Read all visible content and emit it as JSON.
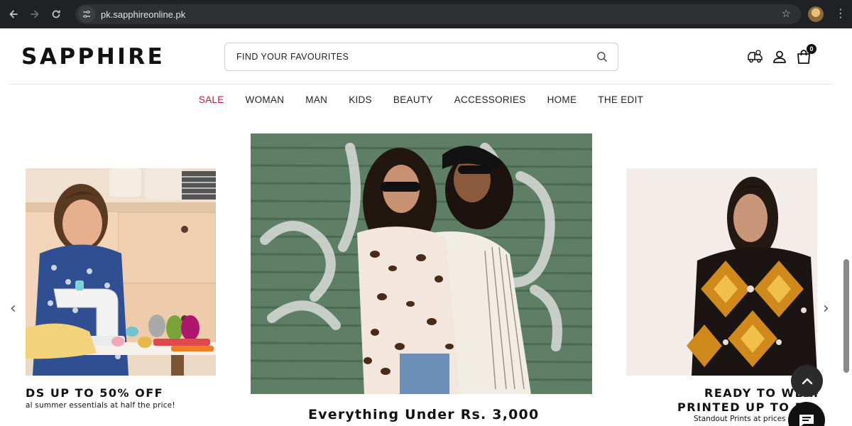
{
  "browser": {
    "url": "pk.sapphireonline.pk"
  },
  "header": {
    "logo": "SAPPHIRE",
    "search_placeholder": "FIND YOUR FAVOURITES",
    "cart_count": "0"
  },
  "nav": {
    "items": [
      {
        "label": "SALE"
      },
      {
        "label": "WOMAN"
      },
      {
        "label": "MAN"
      },
      {
        "label": "KIDS"
      },
      {
        "label": "BEAUTY"
      },
      {
        "label": "ACCESSORIES"
      },
      {
        "label": "HOME"
      },
      {
        "label": "THE EDIT"
      }
    ],
    "sale_color": "#c2183a"
  },
  "carousel": {
    "left": {
      "title": "DS UP TO 50% OFF",
      "subtitle": "al summer essentials at half the price!"
    },
    "center": {
      "title": "Everything Under Rs. 3,000"
    },
    "right": {
      "title_line1": "READY TO WEAR",
      "title_line2": "PRINTED UP TO 5",
      "subtitle": "Standout Prints at prices"
    }
  }
}
